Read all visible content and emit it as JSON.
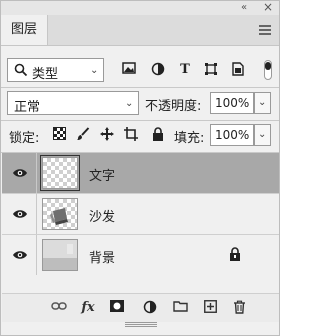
{
  "window": {
    "collapse_glyph": "«",
    "close_glyph": "×"
  },
  "tabs": [
    {
      "label": "图层"
    }
  ],
  "filter": {
    "kind_label": "类型"
  },
  "blend": {
    "mode": "正常",
    "opacity_label": "不透明度:",
    "opacity_value": "100%"
  },
  "locks": {
    "label": "锁定:",
    "fill_label": "填充:",
    "fill_value": "100%"
  },
  "layers": [
    {
      "name": "文字",
      "visible": true,
      "selected": true
    },
    {
      "name": "沙发",
      "visible": true,
      "selected": false
    },
    {
      "name": "背景",
      "visible": true,
      "selected": false,
      "locked": true
    }
  ],
  "bottom_bar": {
    "fx_label": "fx"
  }
}
